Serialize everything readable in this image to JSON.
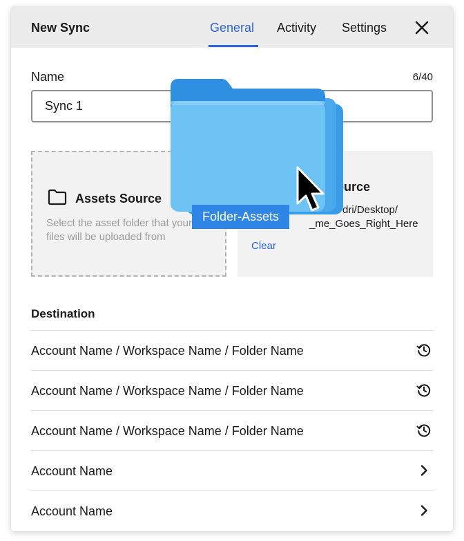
{
  "header": {
    "title": "New Sync",
    "tabs": [
      {
        "label": "General",
        "active": true
      },
      {
        "label": "Activity",
        "active": false
      },
      {
        "label": "Settings",
        "active": false
      }
    ],
    "close_icon": "close-icon"
  },
  "name_field": {
    "label": "Name",
    "counter": "6/40",
    "value": "Sync 1"
  },
  "assets_source_empty": {
    "title": "Assets Source",
    "description": "Select the asset folder that your files will be uploaded from",
    "icon": "folder-outline-icon"
  },
  "assets_source_selected": {
    "title_visible": "ts Source",
    "path_line1": "dri/Desktop/",
    "path_line2": "_me_Goes_Right_Here",
    "clear_label": "Clear"
  },
  "drag": {
    "label": "Folder-Assets",
    "icon": "folder-stack-icon",
    "cursor": "arrow-cursor-icon"
  },
  "destination": {
    "label": "Destination",
    "rows": [
      {
        "text": "Account Name / Workspace Name / Folder Name",
        "icon": "history-icon"
      },
      {
        "text": "Account Name / Workspace Name / Folder Name",
        "icon": "history-icon"
      },
      {
        "text": "Account Name / Workspace Name / Folder Name",
        "icon": "history-icon"
      },
      {
        "text": "Account Name",
        "icon": "chevron-right-icon"
      },
      {
        "text": "Account Name",
        "icon": "chevron-right-icon"
      }
    ]
  },
  "colors": {
    "accent": "#2b63d9",
    "header_bg": "#ececec",
    "panel_bg": "#f2f2f2",
    "folder_blue": "#6ec3f5",
    "drag_label_bg": "#2f86e6"
  }
}
